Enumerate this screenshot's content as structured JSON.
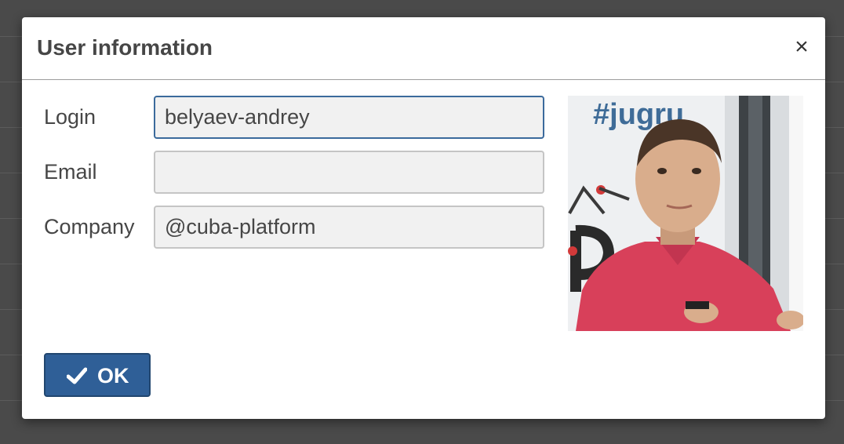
{
  "dialog": {
    "title": "User information",
    "close_glyph": "×"
  },
  "form": {
    "login": {
      "label": "Login",
      "value": "belyaev-andrey",
      "placeholder": ""
    },
    "email": {
      "label": "Email",
      "value": "",
      "placeholder": ""
    },
    "company": {
      "label": "Company",
      "value": "@cuba-platform",
      "placeholder": ""
    }
  },
  "photo": {
    "banner_text": "#jugru",
    "banner_color": "#3f6c98",
    "shirt_color": "#d8405a"
  },
  "buttons": {
    "ok_label": "OK",
    "ok_icon": "checkmark-icon",
    "ok_color": "#2f5f97"
  },
  "icons": {
    "close": "close-icon"
  }
}
